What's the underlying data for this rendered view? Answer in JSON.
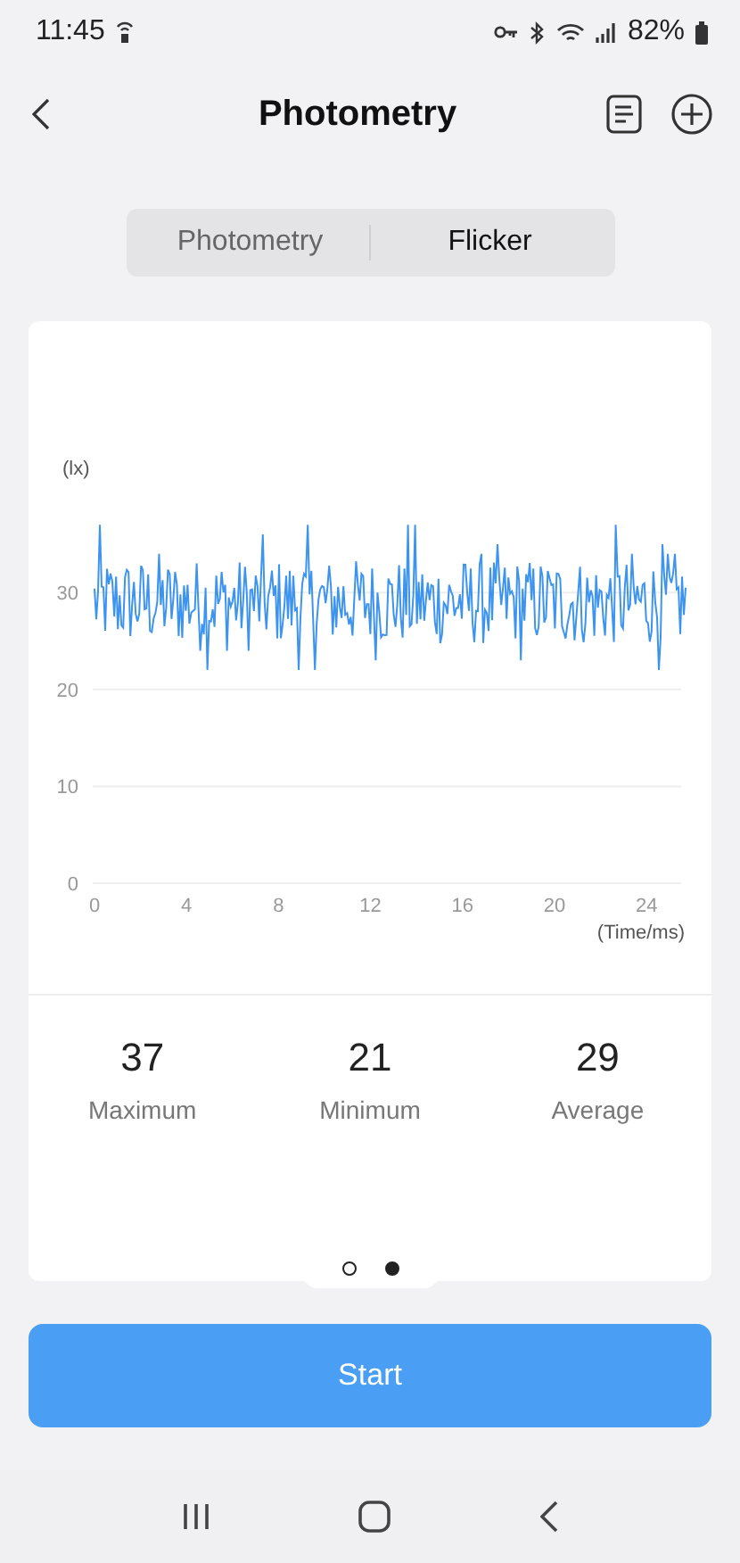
{
  "status_bar": {
    "time": "11:45",
    "battery": "82%"
  },
  "header": {
    "title": "Photometry"
  },
  "tabs": [
    {
      "label": "Photometry",
      "selected": false
    },
    {
      "label": "Flicker",
      "selected": true
    }
  ],
  "chart": {
    "unit": "(lx)",
    "xlabel": "(Time/ms)",
    "yticks": [
      "30",
      "20",
      "10",
      "0"
    ],
    "xticks": [
      "0",
      "4",
      "8",
      "12",
      "16",
      "20",
      "24"
    ]
  },
  "stats": [
    {
      "value": "37",
      "label": "Maximum"
    },
    {
      "value": "21",
      "label": "Minimum"
    },
    {
      "value": "29",
      "label": "Average"
    }
  ],
  "pages": [
    {
      "selected": false
    },
    {
      "selected": true
    }
  ],
  "start_button": {
    "label": "Start"
  }
}
